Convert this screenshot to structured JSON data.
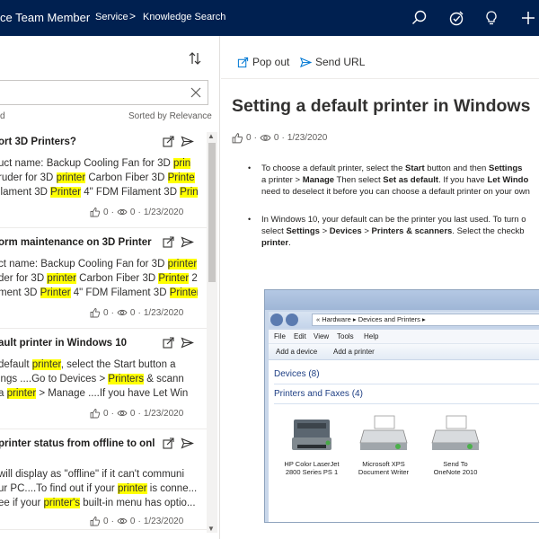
{
  "topbar": {
    "app_title": "ce Team Member",
    "nav_service": "Service",
    "nav_separator": ">",
    "nav_knowledge": "Knowledge Search",
    "icons": [
      "search-icon",
      "task-icon",
      "lightbulb-icon",
      "plus-icon"
    ]
  },
  "left": {
    "search_value": "",
    "results_label": "d",
    "sorted_by": "Sorted by Relevance",
    "results": [
      {
        "title": "ort 3D Printers?",
        "snippet": [
          [
            {
              "t": "uct name:  Backup Cooling Fan for 3D "
            },
            {
              "t": "prin",
              "h": true
            }
          ],
          [
            {
              "t": "ruder for 3D "
            },
            {
              "t": "printer",
              "h": true
            },
            {
              "t": " Carbon Fiber 3D "
            },
            {
              "t": "Printe",
              "h": true
            }
          ],
          [
            {
              "t": "ilament 3D "
            },
            {
              "t": "Printer",
              "h": true
            },
            {
              "t": " 4\" FDM Filament 3D "
            },
            {
              "t": "Print",
              "h": true
            },
            {
              "t": "..."
            }
          ]
        ],
        "likes": "0",
        "views": "0",
        "date": "1/23/2020"
      },
      {
        "title": "orm maintenance on 3D Printer",
        "snippet": [
          [
            {
              "t": "ct name: Backup Cooling Fan for 3D "
            },
            {
              "t": "printer",
              "h": true
            }
          ],
          [
            {
              "t": "der for 3D "
            },
            {
              "t": "printer",
              "h": true
            },
            {
              "t": " Carbon Fiber 3D "
            },
            {
              "t": "Printer",
              "h": true
            },
            {
              "t": " 2"
            }
          ],
          [
            {
              "t": "ment 3D "
            },
            {
              "t": "Printer",
              "h": true
            },
            {
              "t": " 4\" FDM Filament 3D "
            },
            {
              "t": "Printer",
              "h": true
            },
            {
              "t": "..."
            }
          ]
        ],
        "likes": "0",
        "views": "0",
        "date": "1/23/2020"
      },
      {
        "title": "ault printer in Windows 10",
        "snippet": [
          [
            {
              "t": " default "
            },
            {
              "t": "printer",
              "h": true
            },
            {
              "t": ", select the  Start   button a"
            }
          ],
          [
            {
              "t": "ings  ....Go to  Devices   >  "
            },
            {
              "t": "Printers",
              "h": true
            },
            {
              "t": " & scann"
            }
          ],
          [
            {
              "t": "a "
            },
            {
              "t": "printer",
              "h": true
            },
            {
              "t": "  >  Manage  ....If you have  Let Win"
            }
          ]
        ],
        "likes": "0",
        "views": "0",
        "date": "1/23/2020"
      },
      {
        "title": "printer status from offline to onl",
        "snippet": [
          [
            {
              "t": " will display as \"offline\" if it can't communi"
            }
          ],
          [
            {
              "t": "ur PC....To find out if your "
            },
            {
              "t": "printer",
              "h": true
            },
            {
              "t": " is conne..."
            }
          ],
          [
            {
              "t": "ee if your "
            },
            {
              "t": "printer's",
              "h": true
            },
            {
              "t": " built-in menu has optio..."
            }
          ]
        ],
        "likes": "0",
        "views": "0",
        "date": "1/23/2020"
      }
    ]
  },
  "right": {
    "pop_out": "Pop out",
    "send_url": "Send URL",
    "article_title": "Setting a default printer in Windows",
    "likes": "0",
    "views": "0",
    "date": "1/23/2020",
    "bullets": [
      [
        [
          {
            "t": "To choose a default printer, select the "
          },
          {
            "t": "Start",
            "b": true
          },
          {
            "t": "  button and then "
          },
          {
            "t": "Settings",
            "b": true
          }
        ],
        [
          {
            "t": "a printer > "
          },
          {
            "t": "Manage",
            "b": true
          },
          {
            "t": "  Then select "
          },
          {
            "t": "Set as default",
            "b": true
          },
          {
            "t": ". If you have "
          },
          {
            "t": "Let Windo",
            "b": true
          }
        ],
        [
          {
            "t": "need to deselect it before you can choose a default printer on your own"
          }
        ]
      ],
      [
        [
          {
            "t": "In Windows 10, your default can be the printer you last used. To turn o"
          }
        ],
        [
          {
            "t": "select "
          },
          {
            "t": "Settings",
            "b": true
          },
          {
            "t": "  > "
          },
          {
            "t": "Devices",
            "b": true
          },
          {
            "t": " > "
          },
          {
            "t": "Printers & scanners",
            "b": true
          },
          {
            "t": ". Select the checkb"
          }
        ],
        [
          {
            "t": "printer",
            "b": true
          },
          {
            "t": "."
          }
        ]
      ]
    ],
    "screenshot": {
      "path": "«  Hardware  ▸  Devices and Printers  ▸",
      "menu": [
        "File",
        "Edit",
        "View",
        "Tools",
        "Help"
      ],
      "toolbar": [
        "Add a device",
        "Add a printer"
      ],
      "groups": [
        "Devices (8)",
        "Printers and Faxes (4)"
      ],
      "devices": [
        {
          "line1": "HP Color LaserJet",
          "line2": "2800 Series PS 1"
        },
        {
          "line1": "Microsoft XPS",
          "line2": "Document Writer"
        },
        {
          "line1": "Send To",
          "line2": "OneNote 2010"
        }
      ]
    }
  }
}
